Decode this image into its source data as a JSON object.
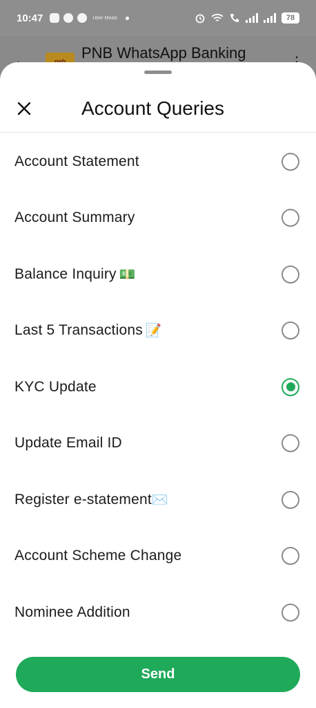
{
  "status_bar": {
    "time": "10:47",
    "mini_label": "Uber Meals",
    "battery": "78"
  },
  "app_bar": {
    "logo_text": "pnb",
    "title": "PNB WhatsApp Banking"
  },
  "sheet": {
    "title": "Account Queries",
    "options": [
      {
        "label": "Account Statement",
        "emoji": "",
        "selected": false
      },
      {
        "label": "Account Summary",
        "emoji": "",
        "selected": false
      },
      {
        "label": "Balance Inquiry",
        "emoji": "💵",
        "selected": false
      },
      {
        "label": "Last 5 Transactions",
        "emoji": "📝",
        "selected": false
      },
      {
        "label": "KYC Update",
        "emoji": "",
        "selected": true
      },
      {
        "label": "Update Email ID",
        "emoji": "",
        "selected": false
      },
      {
        "label": "Register e-statement",
        "emoji": "✉️",
        "selected": false
      },
      {
        "label": "Account Scheme Change",
        "emoji": "",
        "selected": false
      },
      {
        "label": "Nominee Addition",
        "emoji": "",
        "selected": false
      }
    ],
    "send_label": "Send"
  },
  "colors": {
    "accent": "#1faa5a",
    "radio_unchecked": "#8a8a8a"
  }
}
